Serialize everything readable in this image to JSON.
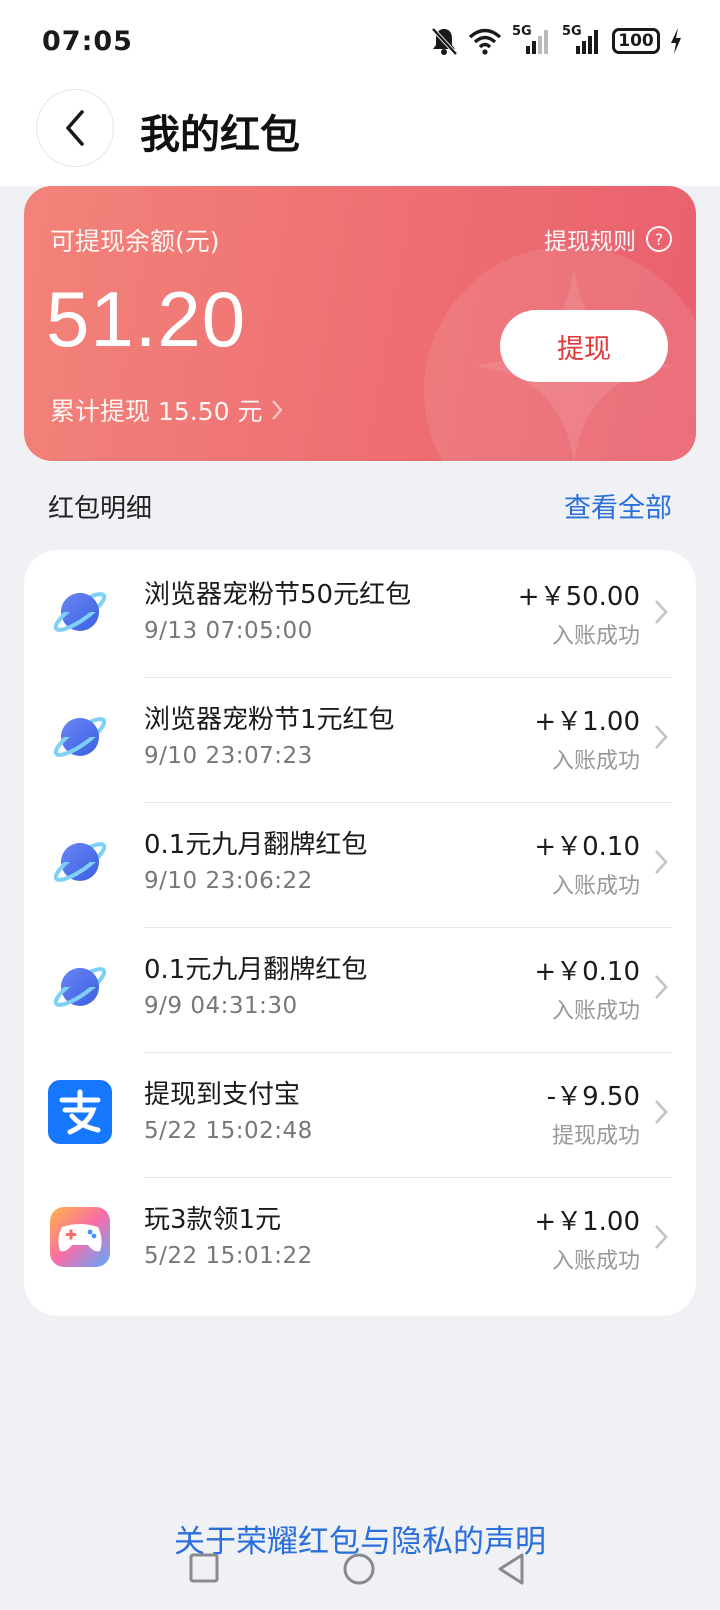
{
  "status_bar": {
    "time": "07:05",
    "network_label_1": "5G",
    "network_label_2": "5G",
    "battery": "100"
  },
  "header": {
    "title": "我的红包"
  },
  "balance": {
    "label": "可提现余额(元)",
    "amount": "51.20",
    "cumulative": "累计提现 15.50 元",
    "rules_label": "提现规则",
    "withdraw_label": "提现"
  },
  "details": {
    "title": "红包明细",
    "view_all": "查看全部",
    "items": [
      {
        "icon": "browser-planet-icon",
        "name": "浏览器宠粉节50元红包",
        "time": "9/13 07:05:00",
        "amount": "+￥50.00",
        "status": "入账成功"
      },
      {
        "icon": "browser-planet-icon",
        "name": "浏览器宠粉节1元红包",
        "time": "9/10 23:07:23",
        "amount": "+￥1.00",
        "status": "入账成功"
      },
      {
        "icon": "browser-planet-icon",
        "name": "0.1元九月翻牌红包",
        "time": "9/10 23:06:22",
        "amount": "+￥0.10",
        "status": "入账成功"
      },
      {
        "icon": "browser-planet-icon",
        "name": "0.1元九月翻牌红包",
        "time": "9/9 04:31:30",
        "amount": "+￥0.10",
        "status": "入账成功"
      },
      {
        "icon": "alipay-icon",
        "name": "提现到支付宝",
        "time": "5/22 15:02:48",
        "amount": "-￥9.50",
        "status": "提现成功"
      },
      {
        "icon": "game-controller-icon",
        "name": "玩3款领1元",
        "time": "5/22 15:01:22",
        "amount": "+￥1.00",
        "status": "入账成功"
      }
    ]
  },
  "footer": {
    "privacy_link": "关于荣耀红包与隐私的声明"
  },
  "colors": {
    "card_gradient_start": "#f2837a",
    "card_gradient_end": "#e9606f",
    "link_blue": "#2a6fdc",
    "withdraw_text": "#e0393a"
  }
}
